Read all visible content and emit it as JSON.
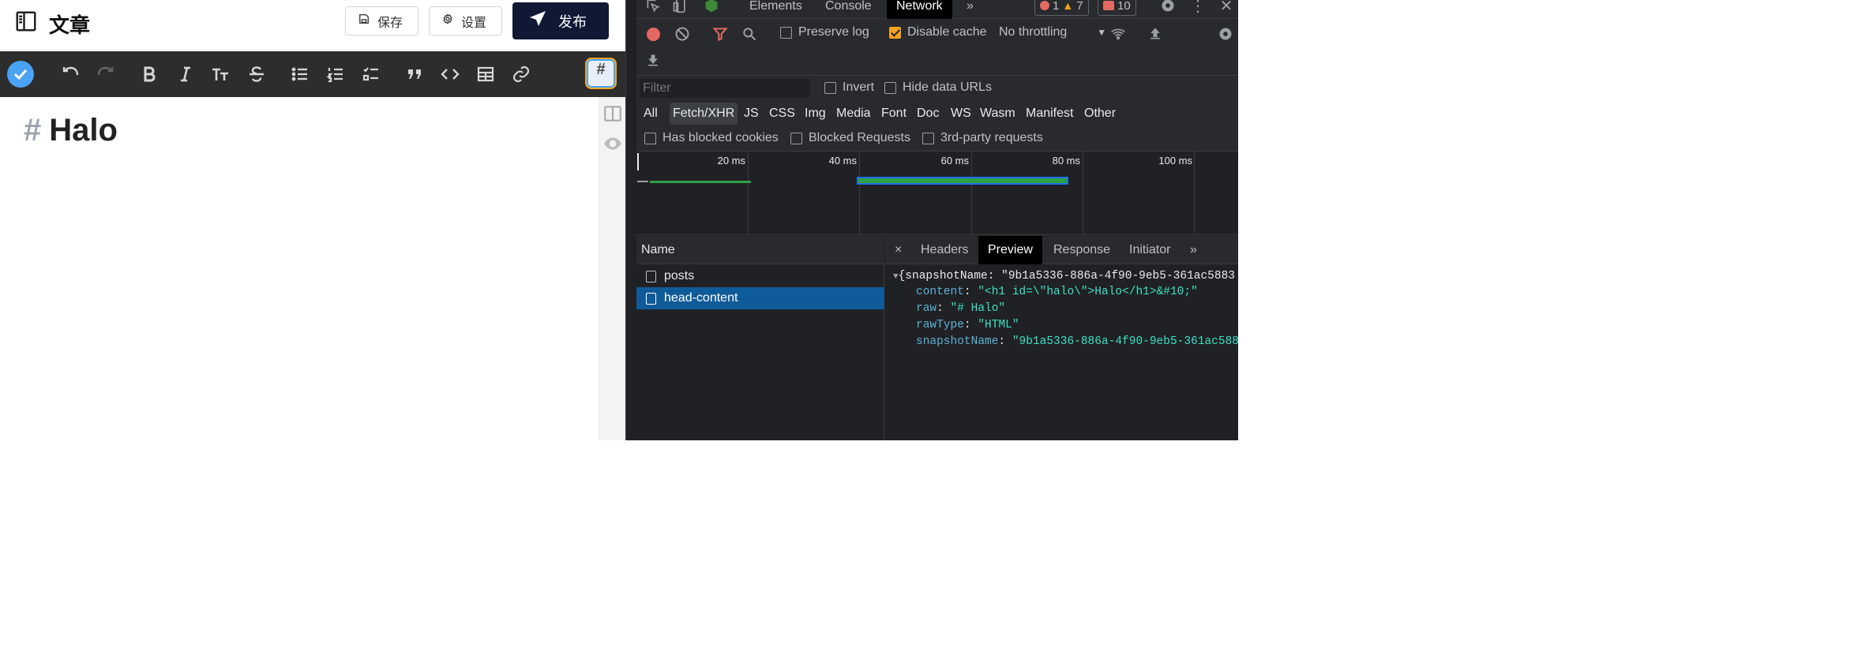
{
  "editor": {
    "title": "文章",
    "save_label": "保存",
    "settings_label": "设置",
    "publish_label": "发布",
    "heading_marker": "#",
    "heading_text": "Halo",
    "toolbar_icons": [
      "check-icon",
      "undo-icon",
      "redo-icon",
      "bold-icon",
      "italic-icon",
      "heading-icon",
      "strikethrough-icon",
      "bullet-list-icon",
      "numbered-list-icon",
      "task-list-icon",
      "quote-icon",
      "code-icon",
      "table-icon",
      "link-icon",
      "hash-icon"
    ],
    "hash_glyph": "#",
    "accent": "#0f1934"
  },
  "devtools": {
    "tabs": [
      "Elements",
      "Console",
      "Network"
    ],
    "active_tab": "Network",
    "more_tabs": "»",
    "errors": "1",
    "warnings": "7",
    "issues": "10",
    "toolbar": {
      "preserve_log": "Preserve log",
      "disable_cache": "Disable cache",
      "throttling": "No throttling"
    },
    "filter": {
      "placeholder": "Filter",
      "invert": "Invert",
      "hide_data_urls": "Hide data URLs",
      "types": [
        "All",
        "Fetch/XHR",
        "JS",
        "CSS",
        "Img",
        "Media",
        "Font",
        "Doc",
        "WS",
        "Wasm",
        "Manifest",
        "Other"
      ],
      "active_type": "Fetch/XHR",
      "has_blocked_cookies": "Has blocked cookies",
      "blocked_requests": "Blocked Requests",
      "third_party": "3rd-party requests"
    },
    "timeline": {
      "ticks": [
        "20 ms",
        "40 ms",
        "60 ms",
        "80 ms",
        "100 ms"
      ]
    },
    "requests": {
      "header": "Name",
      "items": [
        "posts",
        "head-content"
      ],
      "selected": "head-content"
    },
    "detail": {
      "close": "×",
      "tabs": [
        "Headers",
        "Preview",
        "Response",
        "Initiator"
      ],
      "active_tab": "Preview",
      "more": "»",
      "json_root": "{snapshotName: \"9b1a5336-886a-4f90-9eb5-361ac5883",
      "fields": [
        {
          "key": "content",
          "value": "\"<h1 id=\\\"halo\\\">Halo</h1>&#10;\""
        },
        {
          "key": "raw",
          "value": "\"# Halo\""
        },
        {
          "key": "rawType",
          "value": "\"HTML\""
        },
        {
          "key": "snapshotName",
          "value": "\"9b1a5336-886a-4f90-9eb5-361ac588"
        }
      ]
    }
  }
}
